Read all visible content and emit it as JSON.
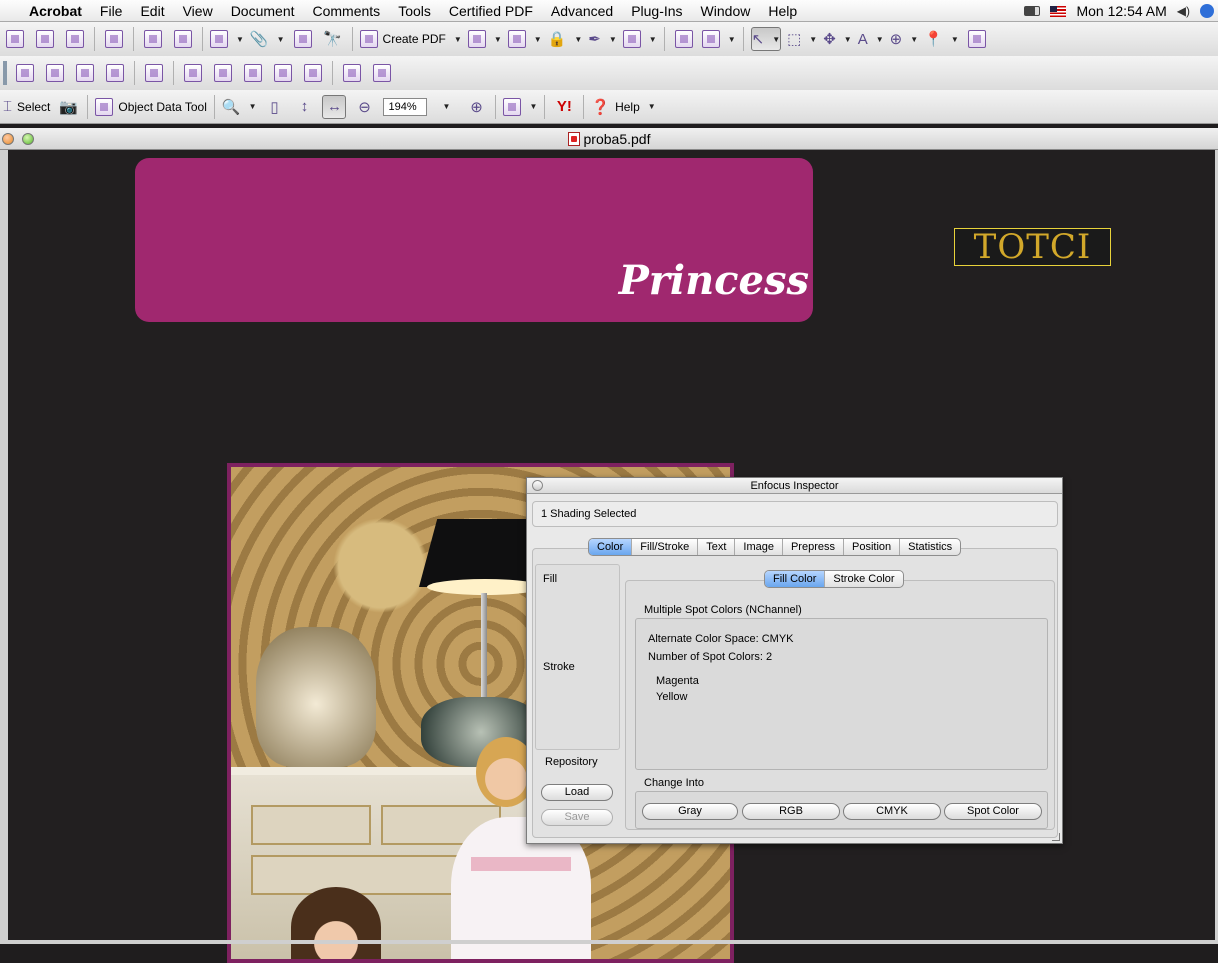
{
  "menubar": {
    "app": "Acrobat",
    "items": [
      "File",
      "Edit",
      "View",
      "Document",
      "Comments",
      "Tools",
      "Certified PDF",
      "Advanced",
      "Plug-Ins",
      "Window",
      "Help"
    ],
    "clock": "Mon 12:54 AM"
  },
  "toolbar1": {
    "create_pdf": "Create PDF"
  },
  "toolbar3": {
    "select": "Select",
    "object_data_tool": "Object Data Tool",
    "zoom_value": "194%",
    "help": "Help"
  },
  "document": {
    "filename": "proba5.pdf",
    "banner_text": "Princess",
    "logo_text": "TOTCI"
  },
  "inspector": {
    "title": "Enfocus Inspector",
    "selection": "1 Shading Selected",
    "tabs": [
      "Color",
      "Fill/Stroke",
      "Text",
      "Image",
      "Prepress",
      "Position",
      "Statistics"
    ],
    "selected_tab": "Color",
    "side": {
      "fill": "Fill",
      "stroke": "Stroke"
    },
    "repository": {
      "label": "Repository",
      "load": "Load",
      "save": "Save"
    },
    "subtabs": [
      "Fill Color",
      "Stroke Color"
    ],
    "color_kind": "Multiple Spot Colors (NChannel)",
    "alternate": "Alternate Color Space: CMYK",
    "num_spot": "Number of Spot Colors: 2",
    "spots": [
      "Magenta",
      "Yellow"
    ],
    "change_into": {
      "label": "Change Into",
      "buttons": [
        "Gray",
        "RGB",
        "CMYK",
        "Spot Color"
      ]
    }
  },
  "colors": {
    "banner": "#a0286f",
    "canvas": "#221f20",
    "selected_tab": "#6aa6ee",
    "logo": "#d2a82a"
  }
}
